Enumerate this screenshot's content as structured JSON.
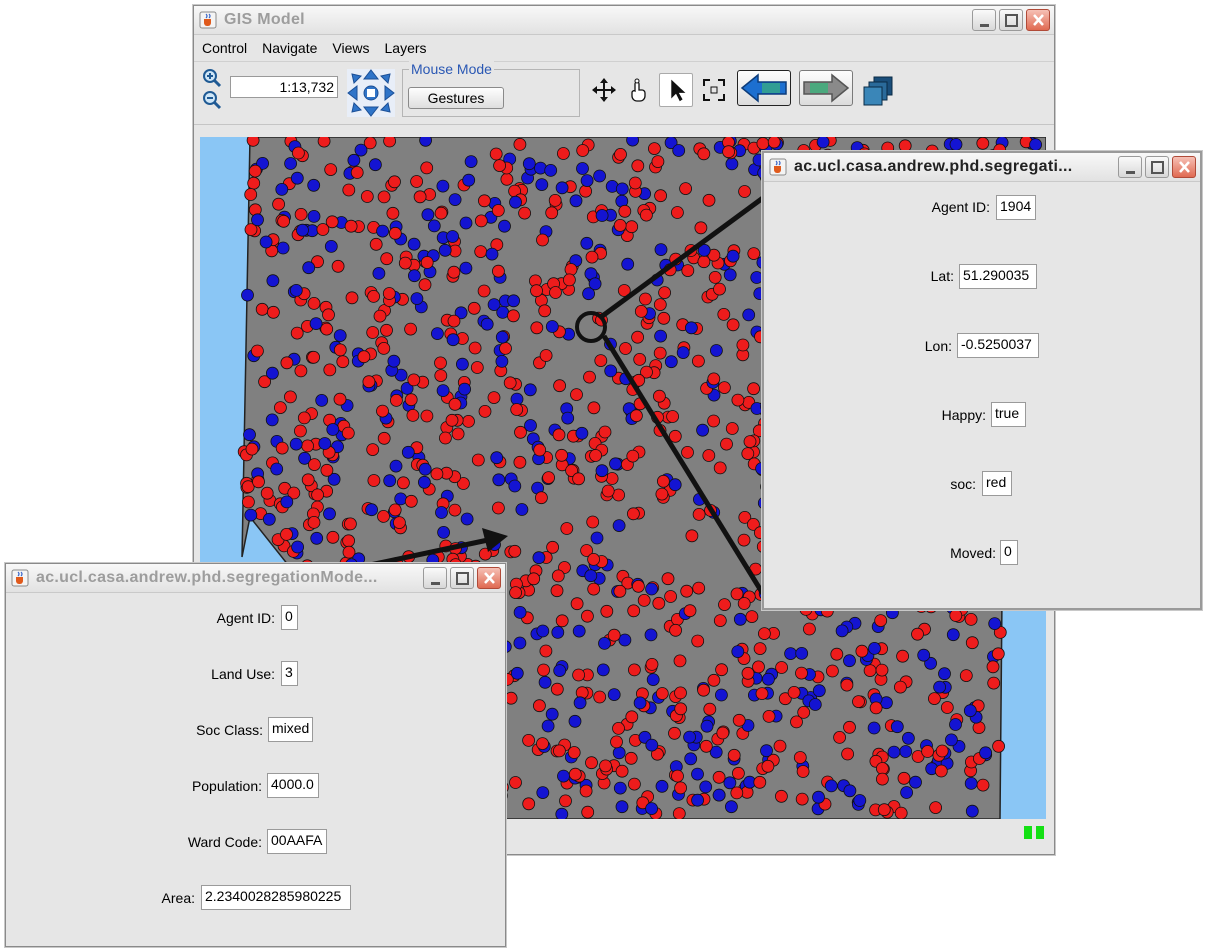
{
  "main_window": {
    "title": "GIS Model",
    "menu": [
      "Control",
      "Navigate",
      "Views",
      "Layers"
    ],
    "scale": "1:13,732",
    "mouse_mode": {
      "label": "Mouse Mode",
      "button": "Gestures"
    }
  },
  "agent_window": {
    "title": "ac.ucl.casa.andrew.phd.segregati...",
    "fields": [
      {
        "label": "Agent ID:",
        "value": "1904"
      },
      {
        "label": "Lat:",
        "value": "51.290035"
      },
      {
        "label": "Lon:",
        "value": "-0.5250037"
      },
      {
        "label": "Happy:",
        "value": "true"
      },
      {
        "label": "soc:",
        "value": "red"
      },
      {
        "label": "Moved:",
        "value": "0"
      }
    ]
  },
  "ward_window": {
    "title": "ac.ucl.casa.andrew.phd.segregationMode...",
    "fields": [
      {
        "label": "Agent ID:",
        "value": "0"
      },
      {
        "label": "Land Use:",
        "value": "3"
      },
      {
        "label": "Soc Class:",
        "value": "mixed"
      },
      {
        "label": "Population:",
        "value": "4000.0"
      },
      {
        "label": "Ward Code:",
        "value": "00AAFA"
      },
      {
        "label": "Area:",
        "value": "2.2340028285980225"
      }
    ]
  },
  "colors": {
    "agent_red": "#ee1c1c",
    "agent_blue": "#1414d2",
    "polygon_gray": "#808080",
    "map_background": "#8ac6f5",
    "status_green": "#14e014"
  },
  "icons": {
    "app": "java-cup-icon",
    "zoom_in": "zoom-in-icon",
    "zoom_out": "zoom-out-icon",
    "pan": "pan-arrows-icon",
    "move": "move-cross-icon",
    "hand": "hand-icon",
    "select": "select-arrow-icon",
    "fullscreen": "fit-extent-icon",
    "back": "back-arrow-icon",
    "forward": "forward-arrow-icon",
    "layers": "layers-stack-icon"
  }
}
